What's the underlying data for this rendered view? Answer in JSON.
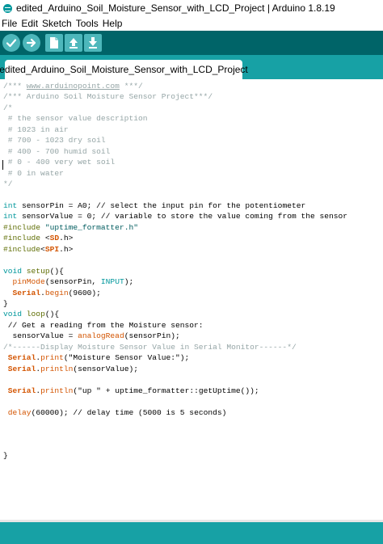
{
  "window": {
    "title": "edited_Arduino_Soil_Moisture_Sensor_with_LCD_Project | Arduino 1.8.19",
    "app_icon": "arduino-icon"
  },
  "menu": [
    "File",
    "Edit",
    "Sketch",
    "Tools",
    "Help"
  ],
  "toolbar": {
    "buttons": [
      {
        "name": "verify",
        "icon": "check-icon"
      },
      {
        "name": "upload",
        "icon": "arrow-right-icon"
      },
      {
        "name": "new",
        "icon": "new-file-icon"
      },
      {
        "name": "open",
        "icon": "open-arrow-up-icon"
      },
      {
        "name": "save",
        "icon": "save-arrow-down-icon"
      }
    ]
  },
  "tabs": [
    {
      "label": "edited_Arduino_Soil_Moisture_Sensor_with_LCD_Project",
      "active": true
    }
  ],
  "code_lines": [
    [
      {
        "t": "/*** ",
        "c": "comment"
      },
      {
        "t": "www.arduinopoint.com",
        "c": "link"
      },
      {
        "t": " ***/",
        "c": "comment"
      }
    ],
    [
      {
        "t": "/*** Arduino Soil Moisture Sensor Project***/",
        "c": "comment"
      }
    ],
    [
      {
        "t": "/*",
        "c": "comment"
      }
    ],
    [
      {
        "t": " # the sensor value description",
        "c": "comment"
      }
    ],
    [
      {
        "t": " # 1023 in air",
        "c": "comment"
      }
    ],
    [
      {
        "t": " # 700 - 1023 dry soil",
        "c": "comment"
      }
    ],
    [
      {
        "t": " # 400 - 700 humid soil",
        "c": "comment"
      }
    ],
    [
      {
        "t": " # 0 - 400 very wet soil",
        "c": "comment"
      }
    ],
    [
      {
        "t": " # 0 in water",
        "c": "comment"
      }
    ],
    [
      {
        "t": "*/",
        "c": "comment"
      }
    ],
    [],
    [
      {
        "t": "int",
        "c": "type"
      },
      {
        "t": " sensorPin = A0; // select the input pin for the potentiometer",
        "c": "plain"
      }
    ],
    [
      {
        "t": "int",
        "c": "type"
      },
      {
        "t": " sensorValue = 0; // variable to store the value coming from the sensor",
        "c": "plain"
      }
    ],
    [
      {
        "t": "#include",
        "c": "kw"
      },
      {
        "t": " \"uptime_formatter.h\"",
        "c": "str"
      }
    ],
    [
      {
        "t": "#include",
        "c": "kw"
      },
      {
        "t": " <",
        "c": "plain"
      },
      {
        "t": "SD",
        "c": "obj"
      },
      {
        "t": ".h>",
        "c": "plain"
      }
    ],
    [
      {
        "t": "#include",
        "c": "kw"
      },
      {
        "t": "<",
        "c": "plain"
      },
      {
        "t": "SPI",
        "c": "obj"
      },
      {
        "t": ".h>",
        "c": "plain"
      }
    ],
    [],
    [
      {
        "t": "void",
        "c": "type"
      },
      {
        "t": " ",
        "c": "plain"
      },
      {
        "t": "setup",
        "c": "kw"
      },
      {
        "t": "(){",
        "c": "plain"
      }
    ],
    [
      {
        "t": "  ",
        "c": "plain"
      },
      {
        "t": "pinMode",
        "c": "func"
      },
      {
        "t": "(sensorPin, ",
        "c": "plain"
      },
      {
        "t": "INPUT",
        "c": "const"
      },
      {
        "t": ");",
        "c": "plain"
      }
    ],
    [
      {
        "t": "  ",
        "c": "plain"
      },
      {
        "t": "Serial",
        "c": "obj"
      },
      {
        "t": ".",
        "c": "plain"
      },
      {
        "t": "begin",
        "c": "func"
      },
      {
        "t": "(9600);",
        "c": "plain"
      }
    ],
    [
      {
        "t": "}",
        "c": "plain"
      }
    ],
    [
      {
        "t": "void",
        "c": "type"
      },
      {
        "t": " ",
        "c": "plain"
      },
      {
        "t": "loop",
        "c": "kw"
      },
      {
        "t": "(){",
        "c": "plain"
      }
    ],
    [
      {
        "t": " // Get a reading from the Moisture sensor:",
        "c": "plain"
      }
    ],
    [
      {
        "t": "  sensorValue = ",
        "c": "plain"
      },
      {
        "t": "analogRead",
        "c": "func"
      },
      {
        "t": "(sensorPin);",
        "c": "plain"
      }
    ],
    [
      {
        "t": "/*------Display Moisture Sensor Value in Serial Monitor------*/",
        "c": "comment"
      }
    ],
    [
      {
        "t": " ",
        "c": "plain"
      },
      {
        "t": "Serial",
        "c": "obj"
      },
      {
        "t": ".",
        "c": "plain"
      },
      {
        "t": "print",
        "c": "func"
      },
      {
        "t": "(\"Moisture Sensor Value:\");",
        "c": "plain"
      }
    ],
    [
      {
        "t": " ",
        "c": "plain"
      },
      {
        "t": "Serial",
        "c": "obj"
      },
      {
        "t": ".",
        "c": "plain"
      },
      {
        "t": "println",
        "c": "func"
      },
      {
        "t": "(sensorValue);",
        "c": "plain"
      }
    ],
    [],
    [
      {
        "t": " ",
        "c": "plain"
      },
      {
        "t": "Serial",
        "c": "obj"
      },
      {
        "t": ".",
        "c": "plain"
      },
      {
        "t": "println",
        "c": "func"
      },
      {
        "t": "(\"up \" + uptime_formatter::getUptime());",
        "c": "plain"
      }
    ],
    [],
    [
      {
        "t": " ",
        "c": "plain"
      },
      {
        "t": "delay",
        "c": "func"
      },
      {
        "t": "(60000); // delay time (5000 is 5 seconds)",
        "c": "plain"
      }
    ],
    [],
    [],
    [],
    [
      {
        "t": "}",
        "c": "plain"
      }
    ]
  ],
  "colors": {
    "toolbar_bg": "#006468",
    "tabstrip_bg": "#17a1a5",
    "button_bg": "#4db7bb",
    "comment": "#95a5a6",
    "type": "#00979c",
    "keyword": "#5e6d03",
    "function": "#d35400"
  }
}
